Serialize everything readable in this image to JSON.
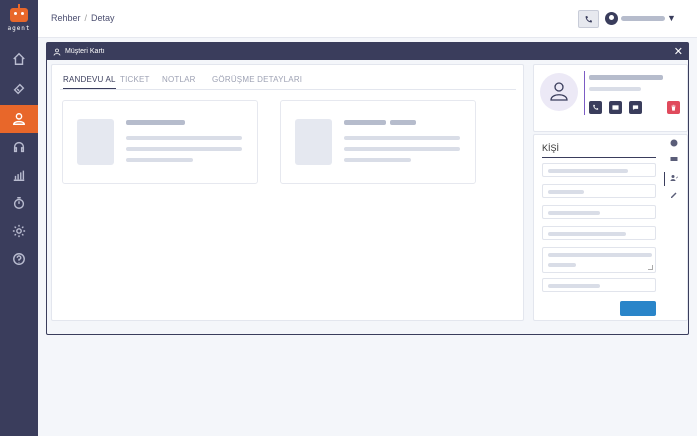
{
  "app": {
    "logo_text": "agent"
  },
  "breadcrumb": {
    "items": [
      "Rehber",
      "Detay"
    ],
    "separator": "/"
  },
  "nav": {
    "items": [
      "home-icon",
      "ticket-icon",
      "user-icon",
      "headset-icon",
      "chart-icon",
      "timer-icon",
      "settings-icon",
      "help-icon"
    ],
    "active": "user-icon"
  },
  "modal": {
    "title": "Müşteri Kartı",
    "close": "✕",
    "tabs": [
      "RANDEVU AL",
      "TICKET",
      "NOTLAR",
      "GÖRÜŞME DETAYLARI"
    ],
    "active_tab": "RANDEVU AL"
  },
  "contact_panel": {
    "title": "KİŞİ"
  },
  "colors": {
    "nav_bg": "#3a3d5c",
    "accent": "#e8672a",
    "primary": "#2a85c9",
    "danger": "#e04a5c"
  }
}
